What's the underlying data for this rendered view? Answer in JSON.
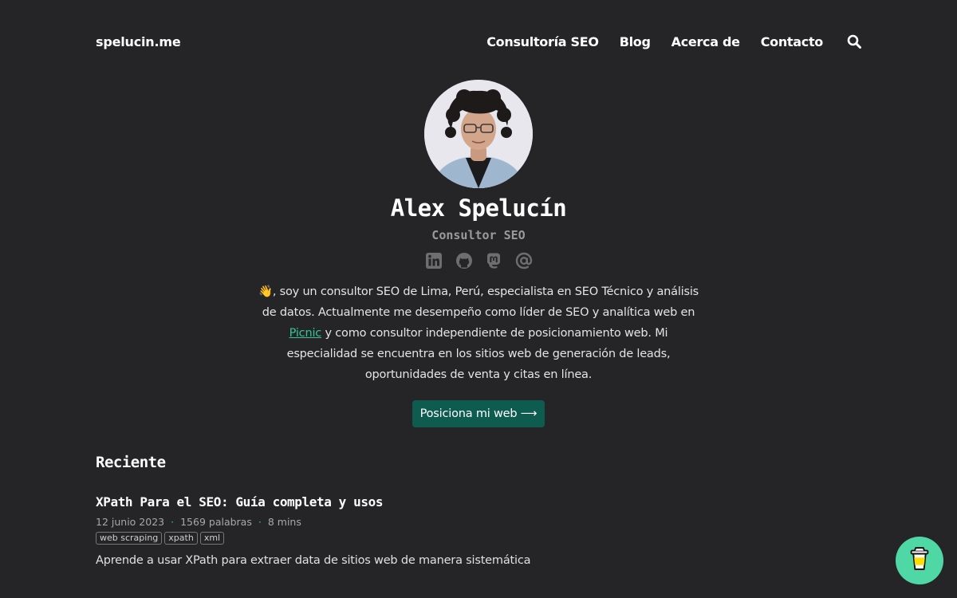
{
  "nav": {
    "brand": "spelucin.me",
    "items": [
      "Consultoría SEO",
      "Blog",
      "Acerca de",
      "Contacto"
    ]
  },
  "profile": {
    "name": "Alex Spelucín",
    "role": "Consultor SEO",
    "social_icons": [
      "linkedin-icon",
      "github-icon",
      "mastodon-icon",
      "email-at-icon"
    ],
    "bio_emoji": "👋",
    "bio_before_link": ", soy un consultor SEO de Lima, Perú, especialista en SEO Técnico y análisis de datos. Actualmente me desempeño como líder de SEO y analítica web en ",
    "bio_link": "Picnic",
    "bio_after_link": " y como consultor independiente de posicionamiento web. Mi especialidad se encuentra en los sitios web de generación de leads, oportunidades de venta y citas en línea.",
    "cta": "Posiciona mi web ⟶"
  },
  "recent": {
    "title": "Reciente",
    "posts": [
      {
        "title": "XPath Para el SEO: Guía completa y usos",
        "date": "12 junio 2023",
        "words": "1569 palabras",
        "read_time": "8 mins",
        "tags": [
          "web scraping",
          "xpath",
          "xml"
        ],
        "description": "Aprende a usar XPath para extraer data de sitios web de manera sistemática"
      }
    ]
  },
  "colors": {
    "background": "#252527",
    "accent_link": "#35c593",
    "button": "#0e5b50",
    "coffee_button": "#4fd8a5"
  },
  "floating": {
    "icon": "coffee-cup-icon"
  }
}
